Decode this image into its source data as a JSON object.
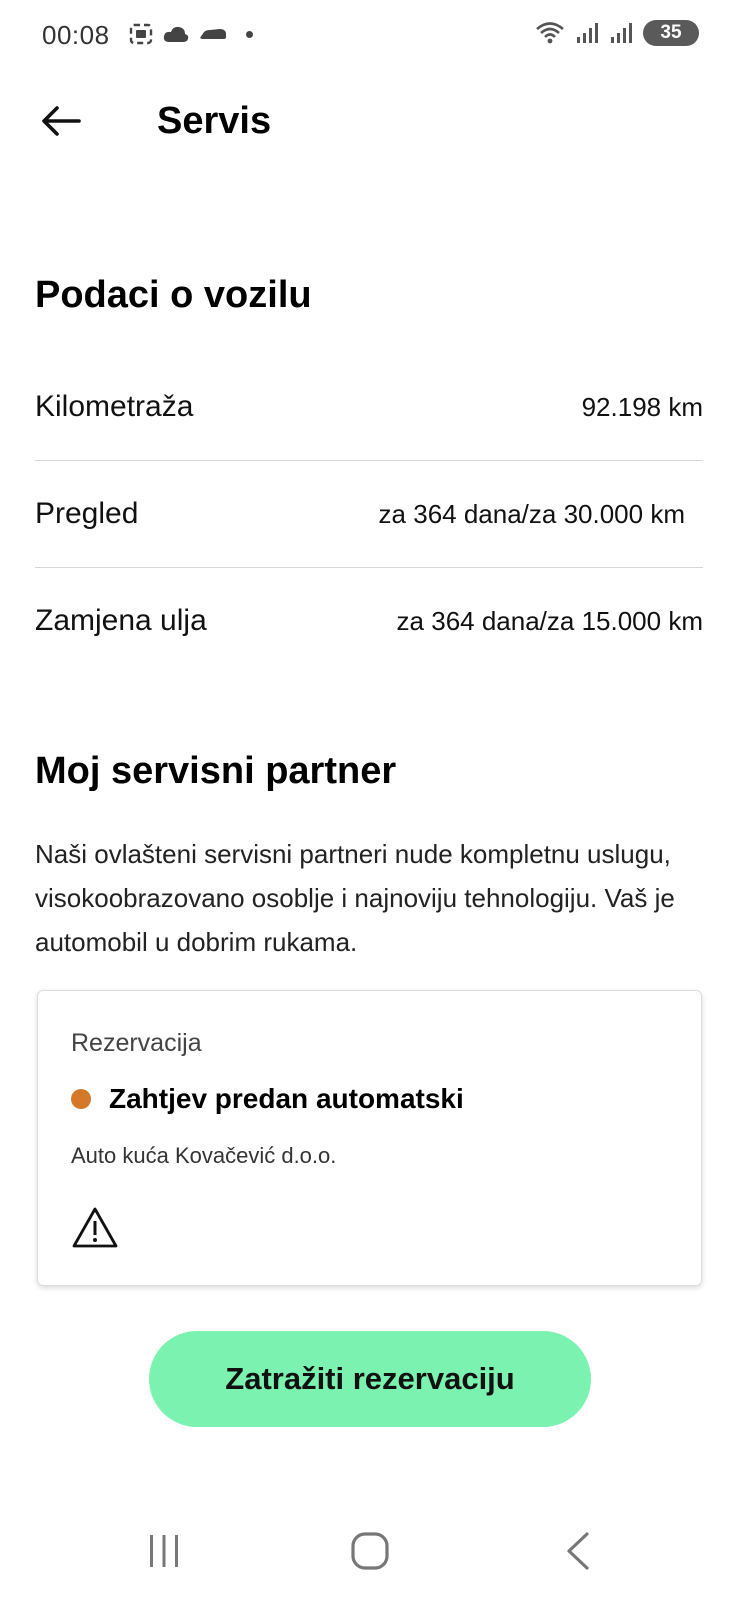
{
  "status_bar": {
    "time": "00:08",
    "battery": "35"
  },
  "app_bar": {
    "title": "Servis"
  },
  "vehicle": {
    "title": "Podaci o vozilu",
    "rows": [
      {
        "label": "Kilometraža",
        "value": "92.198 km"
      },
      {
        "label": "Pregled",
        "value": "za 364 dana/za 30.000 km"
      },
      {
        "label": "Zamjena ulja",
        "value": "za 364 dana/za 15.000 km"
      }
    ]
  },
  "partner": {
    "title": "Moj servisni partner",
    "description": "Naši ovlašteni servisni partneri nude kompletnu uslugu, visokoobrazovano osoblje i najnoviju tehnologiju. Vaš je automobil u dobrim rukama."
  },
  "reservation_card": {
    "label": "Rezervacija",
    "status": "Zahtjev predan automatski",
    "dealer": "Auto kuća Kovačević d.o.o.",
    "status_color": "#D4792A"
  },
  "cta": {
    "label": "Zatražiti rezervaciju",
    "color": "#7CF2B0"
  },
  "icons": {
    "back": "arrow-left-icon",
    "warning": "warning-triangle-icon",
    "nav_recents": "recents-icon",
    "nav_home": "home-icon",
    "nav_back": "chevron-left-icon"
  }
}
